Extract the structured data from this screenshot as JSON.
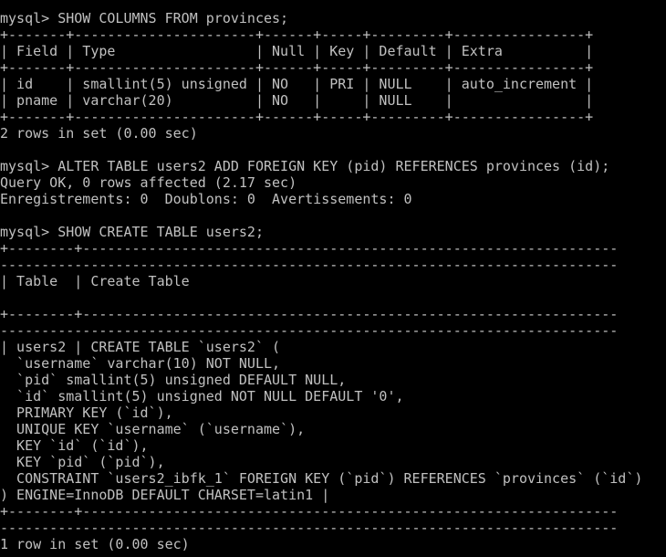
{
  "terminal": {
    "lines": [
      "mysql> SHOW COLUMNS FROM provinces;",
      "+-------+----------------------+------+-----+---------+----------------+",
      "| Field | Type                 | Null | Key | Default | Extra          |",
      "+-------+----------------------+------+-----+---------+----------------+",
      "| id    | smallint(5) unsigned | NO   | PRI | NULL    | auto_increment |",
      "| pname | varchar(20)          | NO   |     | NULL    |                |",
      "+-------+----------------------+------+-----+---------+----------------+",
      "2 rows in set (0.00 sec)",
      "",
      "mysql> ALTER TABLE users2 ADD FOREIGN KEY (pid) REFERENCES provinces (id);",
      "Query OK, 0 rows affected (2.17 sec)",
      "Enregistrements: 0  Doublons: 0  Avertissements: 0",
      "",
      "mysql> SHOW CREATE TABLE users2;",
      "+--------+-----------------------------------------------------------------",
      "---------------------------------------------------------------------------",
      "| Table  | Create Table",
      "",
      "+--------+-----------------------------------------------------------------",
      "---------------------------------------------------------------------------",
      "| users2 | CREATE TABLE `users2` (",
      "  `username` varchar(10) NOT NULL,",
      "  `pid` smallint(5) unsigned DEFAULT NULL,",
      "  `id` smallint(5) unsigned NOT NULL DEFAULT '0',",
      "  PRIMARY KEY (`id`),",
      "  UNIQUE KEY `username` (`username`),",
      "  KEY `id` (`id`),",
      "  KEY `pid` (`pid`),",
      "  CONSTRAINT `users2_ibfk_1` FOREIGN KEY (`pid`) REFERENCES `provinces` (`id`)",
      ") ENGINE=InnoDB DEFAULT CHARSET=latin1 |",
      "+--------+-----------------------------------------------------------------",
      "---------------------------------------------------------------------------",
      "1 row in set (0.00 sec)"
    ]
  }
}
